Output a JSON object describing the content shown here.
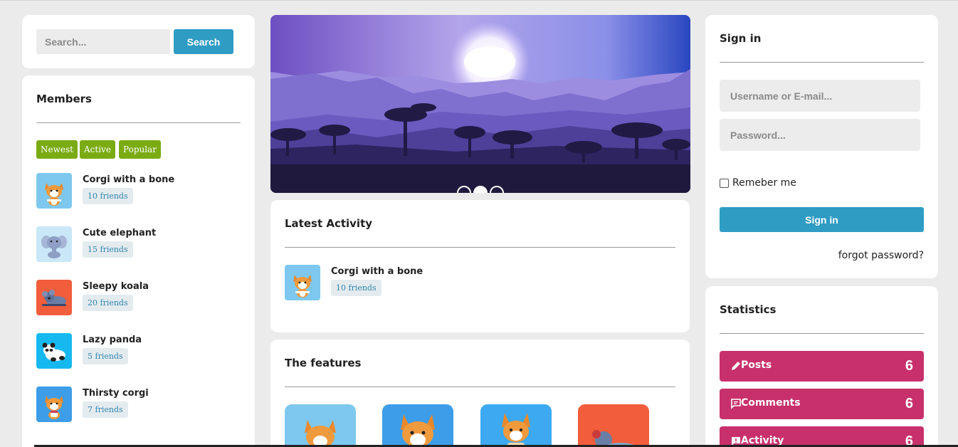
{
  "search": {
    "placeholder": "Search...",
    "button_label": "Search"
  },
  "members": {
    "title": "Members",
    "filters": [
      "Newest",
      "Active",
      "Popular"
    ],
    "list": [
      {
        "name": "Corgi with a bone",
        "friends": "10 friends",
        "avatar_icon": "corgi-bone-icon",
        "bg": "#7ec8f0"
      },
      {
        "name": "Cute elephant",
        "friends": "15 friends",
        "avatar_icon": "elephant-icon",
        "bg": "#c9e7f7"
      },
      {
        "name": "Sleepy koala",
        "friends": "20 friends",
        "avatar_icon": "koala-icon",
        "bg": "#f25d3c"
      },
      {
        "name": "Lazy panda",
        "friends": "5 friends",
        "avatar_icon": "panda-icon",
        "bg": "#16b9ef"
      },
      {
        "name": "Thirsty corgi",
        "friends": "7 friends",
        "avatar_icon": "corgi-drink-icon",
        "bg": "#3d9de8"
      }
    ]
  },
  "activity": {
    "title": "Latest Activity",
    "items": [
      {
        "name": "Corgi with a bone",
        "friends": "10 friends",
        "avatar_icon": "corgi-bone-icon"
      }
    ]
  },
  "features": {
    "title": "The features"
  },
  "signin": {
    "title": "Sign in",
    "username_placeholder": "Username or E-mail...",
    "password_placeholder": "Password...",
    "remember_label": "Remeber me",
    "button_label": "Sign in",
    "forgot_label": "forgot password?"
  },
  "statistics": {
    "title": "Statistics",
    "items": [
      {
        "label": "Posts",
        "count": "6",
        "icon": "pencil-icon"
      },
      {
        "label": "Comments",
        "count": "6",
        "icon": "comment-icon"
      },
      {
        "label": "Activity",
        "count": "6",
        "icon": "alert-icon"
      }
    ]
  },
  "colors": {
    "accent_blue": "#2f9cc4",
    "filter_green": "#7bab13",
    "stat_pink": "#c8306b"
  }
}
